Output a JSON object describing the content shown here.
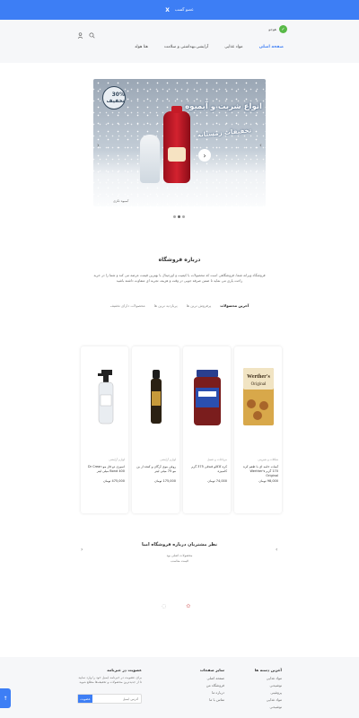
{
  "topbar": {
    "text": "عضو گسب",
    "close": "X"
  },
  "header": {
    "logo_text": "هوجو",
    "icons": [
      "search-icon",
      "user-icon"
    ],
    "nav": [
      {
        "label": "صفحه اصلی",
        "active": true
      },
      {
        "label": "مواد غذایی",
        "active": false
      },
      {
        "label": "آرایشی،بهداشتی و سلامت",
        "active": false
      },
      {
        "label": "هتا هولد",
        "active": false
      }
    ]
  },
  "slider": {
    "badge": "30% تخفیف",
    "headline": "انواع شربت و آبمیوه",
    "subline": "تخفیفات زمستانه",
    "caption": "آبمیوه تکزی",
    "prev": "‹",
    "next": "›",
    "dots": 3,
    "active_dot": 1
  },
  "about": {
    "title": "درباره فروشگاه",
    "text": "فروشگاه ویرانه شما، فروشگاهی است که محصولات با کیفیت و اورجینال با بهترین قیمت عرضه می کند و شما را در خرید راحت یاری می نماید تا ضمن صرفه جویی در وقت و هزینه، تجربه ای متفاوت داشته باشید"
  },
  "tabs": [
    {
      "label": "آخرین محصولات",
      "active": true
    },
    {
      "label": "پرفروش ترین ها",
      "active": false
    },
    {
      "label": "پربازدید ترین ها",
      "active": false
    },
    {
      "label": "محصولات دارای تخفیف",
      "active": false
    }
  ],
  "products": [
    {
      "category": "شکلات و شیرینی",
      "name": "آبنبات خامه ای با طعم کره 170 گرم Werther's Original",
      "price": "98,000 تومان",
      "image": "candy-box"
    },
    {
      "category": "مرباجات و عسل",
      "name": "کره کاکائو فندقی 375 گرم کامبیزه",
      "price": "74,000 تومان",
      "image": "jar"
    },
    {
      "category": "لوازم آرایشی",
      "name": "روغن موی آرگان و کنجد از بن مو 75 میلی لیتر",
      "price": "175,000 تومان",
      "image": "dropper-bottle"
    },
    {
      "category": "لوازم آرایشی",
      "name": "اسپری دو فاز مو Dr Crean Bond 400 میلی لیتر",
      "price": "475,000 تومان",
      "image": "spray-bottle"
    }
  ],
  "reviews": {
    "title": "نظر مشتریان درباره فروشگاه امیا",
    "text": "محصولات اصلی بود\nقیمت مناسب",
    "prev": "‹",
    "next": "›"
  },
  "footer": {
    "col1": {
      "title": "آخرین دسته ها",
      "links": [
        "مواد غذایی",
        "نوشیدنی",
        "پروتئینی",
        "مواد غذایی",
        "نوشیدنی"
      ]
    },
    "col2": {
      "title": "سایر صفحات",
      "links": [
        "صفحه اصلی",
        "فروشگاه من",
        "درباره ما",
        "تماس با ما"
      ]
    },
    "col3": {
      "title": "عضویت در خبرنامه",
      "text": "برای عضویت در خبرنامه ایمیل خود را وارد نمایید تا از جدیدترین محصولات و تخفیف‌ها مطلع شوید",
      "placeholder": "آدرس ایمیل",
      "button": "عضویت"
    }
  },
  "floating_button": "↑",
  "colors": {
    "primary": "#3d7ef5",
    "logo": "#58b947",
    "footer_bg": "#f6f7f9"
  }
}
